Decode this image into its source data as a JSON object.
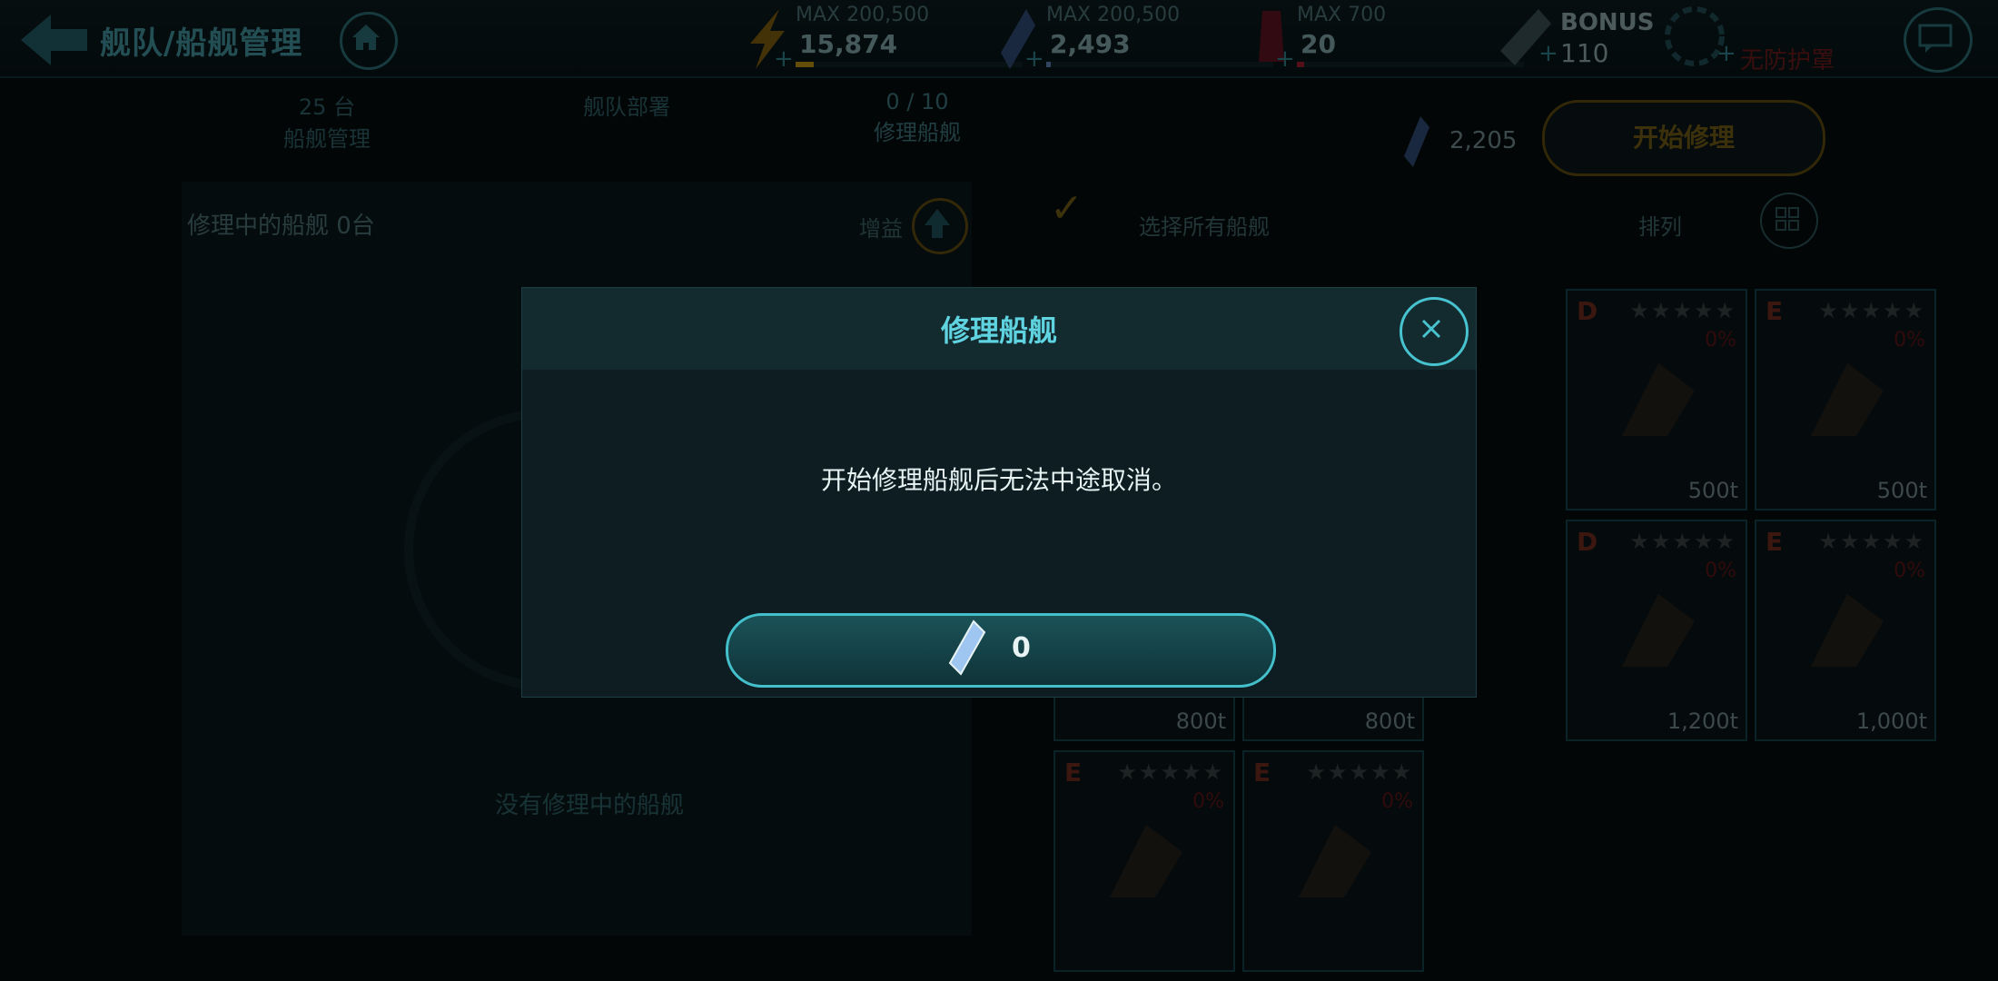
{
  "header": {
    "title": "舰队/船舰管理",
    "resources": [
      {
        "name": "energy",
        "max": "MAX 200,500",
        "value": "15,874",
        "fill": 0.08,
        "color": "#b28e12"
      },
      {
        "name": "crystal",
        "max": "MAX 200,500",
        "value": "2,493",
        "fill": 0.01,
        "color": "#5b7fb0"
      },
      {
        "name": "fuel",
        "max": "MAX 700",
        "value": "20",
        "fill": 0.03,
        "color": "#9a1d2c"
      }
    ],
    "bonus": {
      "label": "BONUS",
      "value": "110"
    },
    "shield_status": "无防护罩"
  },
  "tabs": [
    {
      "count": "25 台",
      "label": "船舰管理"
    },
    {
      "count": "",
      "label": "舰队部署"
    },
    {
      "count": "0 / 10",
      "label": "修理船舰"
    }
  ],
  "left": {
    "subhead": "修理中的船舰  0台",
    "boost_label": "增益",
    "empty_text": "没有修理中的船舰"
  },
  "right": {
    "cost_value": "2,205",
    "start_repair": "开始修理",
    "select_all": "选择所有船舰",
    "sort": "排列"
  },
  "ships": [
    {
      "grade": "D",
      "stars": "★★★★★",
      "pct": "0%",
      "ton": "500t"
    },
    {
      "grade": "E",
      "stars": "★★★★★",
      "pct": "0%",
      "ton": "500t"
    },
    {
      "grade": "D",
      "stars": "★★★★★",
      "pct": "0%",
      "ton": "1,200t"
    },
    {
      "grade": "E",
      "stars": "★★★★★",
      "pct": "0%",
      "ton": "1,000t"
    },
    {
      "grade": "",
      "stars": "",
      "pct": "",
      "ton": "800t"
    },
    {
      "grade": "",
      "stars": "",
      "pct": "",
      "ton": "800t"
    },
    {
      "grade": "E",
      "stars": "★★★★★",
      "pct": "0%",
      "ton": ""
    },
    {
      "grade": "E",
      "stars": "★★★★★",
      "pct": "0%",
      "ton": ""
    }
  ],
  "dialog": {
    "title": "修理船舰",
    "message": "开始修理船舰后无法中途取消。",
    "cost": "0"
  }
}
